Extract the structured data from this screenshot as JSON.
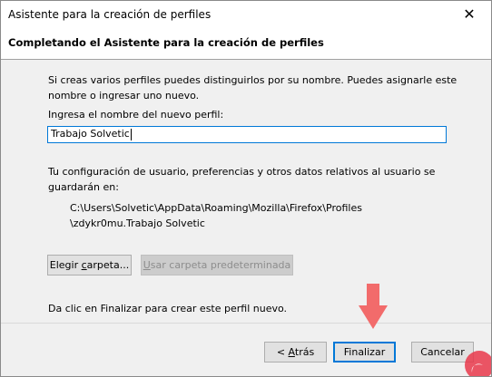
{
  "window": {
    "title": "Asistente para la creación de perfiles",
    "close_glyph": "✕"
  },
  "header": {
    "title": "Completando el Asistente para la creación de perfiles"
  },
  "content": {
    "intro_line1": "Si creas varios perfiles puedes distinguirlos por su nombre. Puedes asignarle este",
    "intro_line2": "nombre o ingresar uno nuevo.",
    "name_label": "Ingresa el nombre del nuevo perfil:",
    "name_value": "Trabajo Solvetic",
    "config_line1": "Tu configuración de usuario, preferencias y otros datos relativos al usuario se",
    "config_line2": "guardarán en:",
    "path_line1": "C:\\Users\\Solvetic\\AppData\\Roaming\\Mozilla\\Firefox\\Profiles",
    "path_line2": "\\zdykr0mu.Trabajo Solvetic",
    "choose_folder_prefix": "Elegir ",
    "choose_folder_underlined": "c",
    "choose_folder_suffix": "arpeta...",
    "default_folder_underlined": "U",
    "default_folder_suffix": "sar carpeta predeterminada",
    "finish_hint": "Da clic en Finalizar para crear este perfil nuevo."
  },
  "footer": {
    "back_prefix": "< ",
    "back_underlined": "A",
    "back_suffix": "trás",
    "finish_label": "Finalizar",
    "cancel_label": "Cancelar"
  },
  "colors": {
    "accent": "#0078d7",
    "arrow": "#f26b6b",
    "logo": "#e9384b"
  },
  "icons": {
    "close": "close-icon",
    "arrow": "arrow-down-icon",
    "logo": "watermark-logo-icon"
  }
}
